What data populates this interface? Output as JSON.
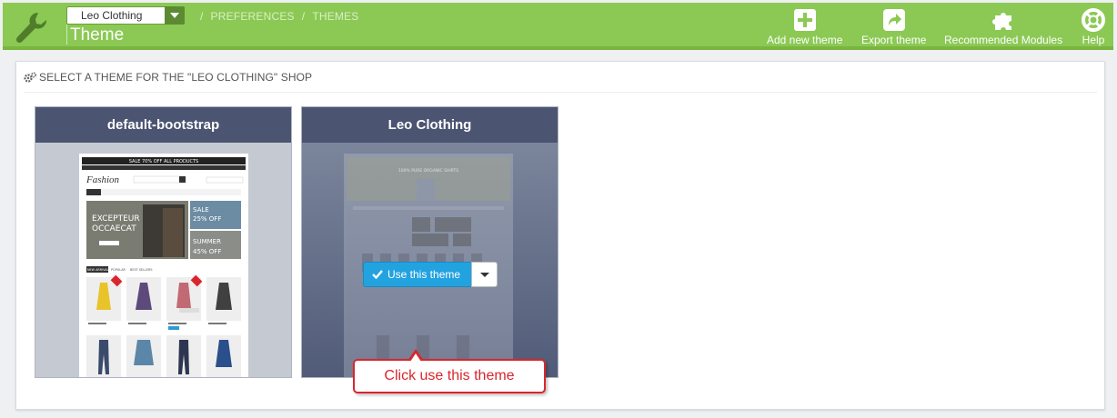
{
  "header": {
    "shop_selector": {
      "value": "Leo Clothing"
    },
    "breadcrumb": [
      "PREFERENCES",
      "THEMES"
    ],
    "title": "Theme",
    "toolbar": [
      {
        "label": "Add new theme",
        "icon": "plus-square-icon"
      },
      {
        "label": "Export theme",
        "icon": "share-icon"
      },
      {
        "label": "Recommended Modules",
        "icon": "puzzle-icon"
      },
      {
        "label": "Help",
        "icon": "lifebuoy-icon"
      }
    ]
  },
  "panel": {
    "heading": "SELECT A THEME FOR THE \"LEO CLOTHING\" SHOP",
    "themes": [
      {
        "name": "default-bootstrap",
        "preview": {
          "banner": "SALE 70% OFF ALL PRODUCTS",
          "logo": "Fashion",
          "hero": [
            "EXCEPTEUR",
            "OCCAECAT"
          ],
          "promo_sale": [
            "SALE",
            "25% OFF"
          ],
          "promo_summer": [
            "SUMMER",
            "45% OFF"
          ],
          "tabs": [
            "NEW ARRIVALS",
            "POPULAR",
            "BEST SELLERS"
          ]
        }
      },
      {
        "name": "Leo Clothing",
        "preview": {
          "banner": "100% PURE ORGANIC SHIRTS"
        },
        "action_label": "Use this theme"
      }
    ]
  },
  "callout": "Click use this theme",
  "colors": {
    "header_green": "#8bc954",
    "card_header": "#4b5571",
    "primary_blue": "#22a3e0",
    "callout_red": "#d9262d"
  }
}
